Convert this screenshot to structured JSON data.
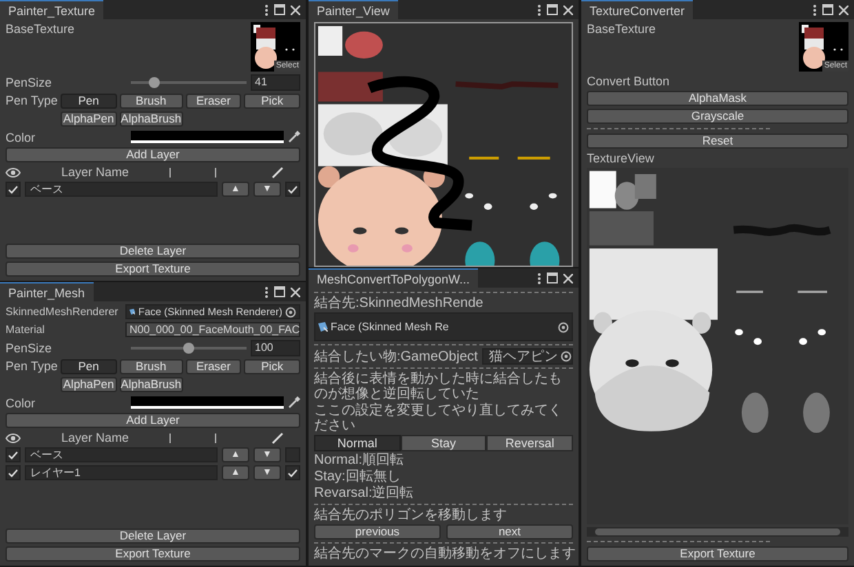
{
  "painter_texture": {
    "title": "Painter_Texture",
    "base_texture": {
      "label": "BaseTexture",
      "select": "Select"
    },
    "pen_size": {
      "label": "PenSize",
      "level": 0.2,
      "value": "41"
    },
    "pen_type": {
      "label": "Pen Type",
      "options": [
        {
          "label": "Pen",
          "selected": true
        },
        {
          "label": "Brush",
          "selected": false
        },
        {
          "label": "Eraser",
          "selected": false
        },
        {
          "label": "Pick",
          "selected": false
        },
        {
          "label": "AlphaPen",
          "selected": false
        },
        {
          "label": "AlphaBrush",
          "selected": false
        }
      ]
    },
    "color_label": "Color",
    "add_layer": "Add Layer",
    "layer_header": "Layer Name",
    "layers": [
      {
        "visible": true,
        "name": "ベース",
        "up": "▲",
        "down": "▼",
        "active": true
      }
    ],
    "delete_layer": "Delete Layer",
    "export": "Export Texture"
  },
  "painter_view": {
    "title": "Painter_View"
  },
  "texture_converter": {
    "title": "TextureConverter",
    "base_texture": {
      "label": "BaseTexture",
      "select": "Select"
    },
    "convert_label": "Convert Button",
    "convert_buttons": [
      "AlphaMask",
      "Grayscale"
    ],
    "reset": "Reset",
    "texture_view_label": "TextureView",
    "export": "Export Texture"
  },
  "painter_mesh": {
    "title": "Painter_Mesh",
    "renderer": {
      "label": "SkinnedMeshRenderer",
      "value": "Face (Skinned Mesh Renderer)"
    },
    "material": {
      "label": "Material",
      "value": "N00_000_00_FaceMouth_00_FAC"
    },
    "pen_size": {
      "label": "PenSize",
      "level": 0.5,
      "value": "100"
    },
    "pen_type": {
      "label": "Pen Type",
      "options": [
        {
          "label": "Pen",
          "selected": true
        },
        {
          "label": "Brush",
          "selected": false
        },
        {
          "label": "Eraser",
          "selected": false
        },
        {
          "label": "Pick",
          "selected": false
        },
        {
          "label": "AlphaPen",
          "selected": false
        },
        {
          "label": "AlphaBrush",
          "selected": false
        }
      ]
    },
    "color_label": "Color",
    "add_layer": "Add Layer",
    "layer_header": "Layer Name",
    "layers": [
      {
        "visible": true,
        "name": "ベース",
        "up": "▲",
        "down": "▼",
        "active": false
      },
      {
        "visible": true,
        "name": "レイヤー1",
        "up": "▲",
        "down": "▼",
        "active": true
      }
    ],
    "delete_layer": "Delete Layer",
    "export": "Export Texture"
  },
  "mesh_convert": {
    "title": "MeshConvertToPolygonW...",
    "target": {
      "label": "結合先:SkinnedMeshRende",
      "value": "Face (Skinned Mesh Re"
    },
    "object": {
      "label": "結合したい物:GameObject",
      "value": "猫ヘアピン"
    },
    "notes": [
      "結合後に表情を動かした時に結合したものが想像と逆回転していた",
      "ここの設定を変更してやり直してみてください"
    ],
    "rotation_modes": [
      {
        "label": "Normal",
        "selected": true
      },
      {
        "label": "Stay",
        "selected": false
      },
      {
        "label": "Reversal",
        "selected": false
      }
    ],
    "descriptions": [
      "Normal:順回転",
      "Stay:回転無し",
      "Revarsal:逆回転"
    ],
    "move_label": "結合先のポリゴンを移動します",
    "nav_buttons": [
      "previous",
      "next"
    ],
    "auto_move_label": "結合先のマークの自動移動をオフにします"
  }
}
